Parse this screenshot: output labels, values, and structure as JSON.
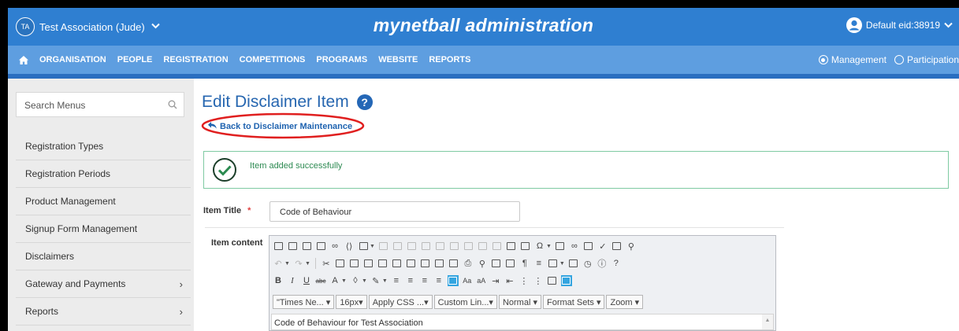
{
  "header": {
    "org_initials": "TA",
    "org_name": "Test Association (Jude)",
    "app_title": "mynetball administration",
    "user_label": "Default eid:38919"
  },
  "nav": {
    "items": [
      "ORGANISATION",
      "PEOPLE",
      "REGISTRATION",
      "COMPETITIONS",
      "PROGRAMS",
      "WEBSITE",
      "REPORTS"
    ],
    "active": "REGISTRATION",
    "modes": [
      "Management",
      "Participation"
    ],
    "selected_mode": "Management"
  },
  "sidebar": {
    "search_placeholder": "Search Menus",
    "items": [
      {
        "label": "Registration Types"
      },
      {
        "label": "Registration Periods"
      },
      {
        "label": "Product Management"
      },
      {
        "label": "Signup Form Management"
      },
      {
        "label": "Disclaimers"
      },
      {
        "label": "Gateway and Payments",
        "arrow": "›"
      },
      {
        "label": "Reports",
        "arrow": "›"
      }
    ]
  },
  "page": {
    "title": "Edit Disclaimer Item",
    "help_glyph": "?",
    "back_link": "Back to Disclaimer Maintenance",
    "success_message": "Item added successfully"
  },
  "form": {
    "item_title_label": "Item Title",
    "required_marker": "*",
    "item_title_value": "Code of Behaviour",
    "item_content_label": "Item content",
    "selects": [
      "\"Times Ne... ▾",
      "16px▾",
      "Apply CSS ...▾",
      "Custom Lin...▾",
      "Normal        ▾",
      "Format Sets ▾",
      "Zoom ▾"
    ],
    "content_text": "Code of Behaviour for Test Association"
  },
  "colors": {
    "topbar": "#2f7fd1",
    "navbar": "#5e9ee0",
    "title": "#2666b0",
    "success_border": "#7fcaa2",
    "highlight_ellipse": "#e01f1f"
  }
}
